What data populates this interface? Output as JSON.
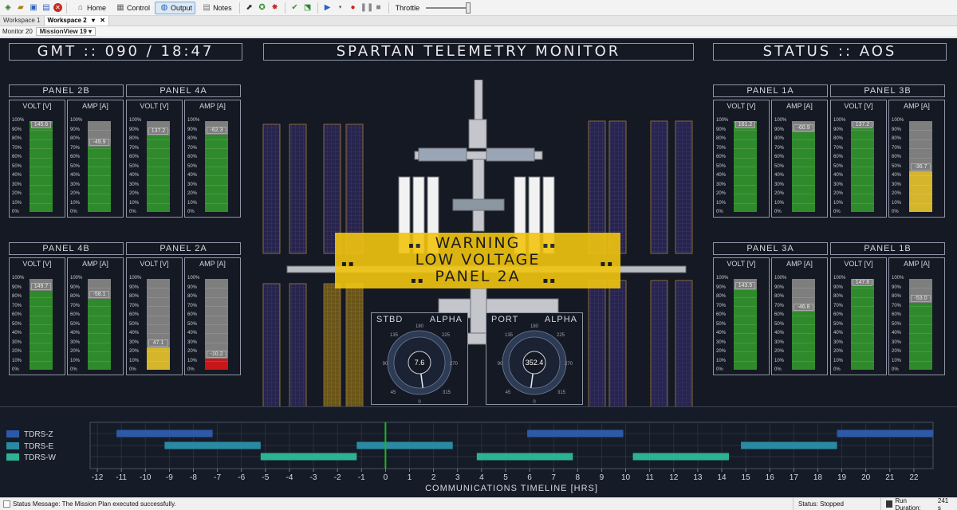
{
  "toolbar": {
    "home": "Home",
    "control": "Control",
    "output": "Output",
    "notes": "Notes",
    "throttle": "Throttle"
  },
  "workspaces": [
    {
      "label": "Workspace 1",
      "active": false
    },
    {
      "label": "Workspace 2",
      "active": true
    }
  ],
  "monitor": {
    "label": "Monitor 20",
    "view": "MissionView 19"
  },
  "header": {
    "gmt": "GMT :: 090 / 18:47",
    "title": "SPARTAN TELEMETRY MONITOR",
    "status": "STATUS :: AOS"
  },
  "scale_labels": [
    "100%",
    "90%",
    "80%",
    "70%",
    "60%",
    "50%",
    "40%",
    "30%",
    "20%",
    "10%",
    "0%"
  ],
  "volt_label": "VOLT [V]",
  "amp_label": "AMP [A]",
  "panels": [
    {
      "name": "PANEL 2B",
      "volt": "145.6",
      "volt_pct": 0.97,
      "volt_state": "ok",
      "amp": "-49.9",
      "amp_pct": 0.72,
      "amp_state": "ok"
    },
    {
      "name": "PANEL 4A",
      "volt": "137.2",
      "volt_pct": 0.84,
      "volt_state": "ok",
      "amp": "-62.3",
      "amp_pct": 0.85,
      "amp_state": "ok"
    },
    {
      "name": "PANEL 4B",
      "volt": "149.7",
      "volt_pct": 0.87,
      "volt_state": "ok",
      "amp": "-58.1",
      "amp_pct": 0.78,
      "amp_state": "ok"
    },
    {
      "name": "PANEL 2A",
      "volt": "47.1",
      "volt_pct": 0.25,
      "volt_state": "warn",
      "amp": "-10.2",
      "amp_pct": 0.12,
      "amp_state": "crit"
    },
    {
      "name": "PANEL 1A",
      "volt": "161.2",
      "volt_pct": 0.98,
      "volt_state": "ok",
      "amp": "-60.9",
      "amp_pct": 0.88,
      "amp_state": "ok"
    },
    {
      "name": "PANEL 3B",
      "volt": "137.2",
      "volt_pct": 0.94,
      "volt_state": "ok",
      "amp": "-36.7",
      "amp_pct": 0.45,
      "amp_state": "warn"
    },
    {
      "name": "PANEL 3A",
      "volt": "143.5",
      "volt_pct": 0.88,
      "volt_state": "ok",
      "amp": "-46.8",
      "amp_pct": 0.64,
      "amp_state": "ok"
    },
    {
      "name": "PANEL 1B",
      "volt": "147.6",
      "volt_pct": 0.93,
      "volt_state": "ok",
      "amp": "-53.0",
      "amp_pct": 0.74,
      "amp_state": "ok"
    }
  ],
  "warning": {
    "line1": "WARNING",
    "line2": "LOW VOLTAGE",
    "line3": "PANEL 2A"
  },
  "alpha": [
    {
      "side": "STBD",
      "label": "ALPHA",
      "value": "7.6",
      "angle": 7.6
    },
    {
      "side": "PORT",
      "label": "ALPHA",
      "value": "352.4",
      "angle": 352.4
    }
  ],
  "dial_labels": [
    "0",
    "45",
    "90",
    "135",
    "180",
    "225",
    "270",
    "315"
  ],
  "timeline": {
    "xlabel": "COMMUNICATIONS TIMELINE [HRS]",
    "ticks": [
      "-12",
      "-11",
      "-10",
      "-9",
      "-8",
      "-7",
      "-6",
      "-5",
      "-4",
      "-3",
      "-2",
      "-1",
      "0",
      "1",
      "2",
      "3",
      "4",
      "5",
      "6",
      "7",
      "8",
      "9",
      "10",
      "11",
      "12",
      "13",
      "14",
      "15",
      "16",
      "17",
      "18",
      "19",
      "20",
      "21",
      "22"
    ],
    "tracks": [
      {
        "name": "TDRS-Z",
        "color": "#2d5aa8",
        "segments": [
          [
            -11.2,
            -7.2
          ],
          [
            5.9,
            9.9
          ],
          [
            18.8,
            22.8
          ]
        ]
      },
      {
        "name": "TDRS-E",
        "color": "#2a8aa4",
        "segments": [
          [
            -9.2,
            -5.2
          ],
          [
            -1.2,
            2.8
          ],
          [
            14.8,
            18.8
          ]
        ]
      },
      {
        "name": "TDRS-W",
        "color": "#2bb394",
        "segments": [
          [
            -5.2,
            -1.2
          ],
          [
            3.8,
            7.8
          ],
          [
            10.3,
            14.3
          ]
        ]
      }
    ],
    "now": 0,
    "xlim": [
      -12.3,
      22.8
    ]
  },
  "statusbar": {
    "message": "Status Message: The Mission Plan executed successfully.",
    "status": "Status: Stopped",
    "run_label": "Run Duration:",
    "run_value": "241 s"
  }
}
